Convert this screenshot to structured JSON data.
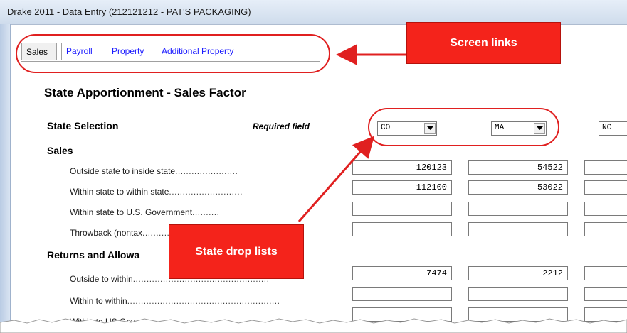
{
  "window": {
    "title": "Drake 2011 - Data Entry (212121212 - PAT'S PACKAGING)"
  },
  "tabs": [
    {
      "label": "Sales",
      "active": true
    },
    {
      "label": "Payroll",
      "active": false
    },
    {
      "label": "Property",
      "active": false
    },
    {
      "label": "Additional Property",
      "active": false
    }
  ],
  "page": {
    "heading": "State Apportionment - Sales Factor",
    "state_selection_label": "State Selection",
    "required_label": "Required field"
  },
  "states": {
    "col1": "CO",
    "col2": "MA",
    "col3": "NC"
  },
  "sales": {
    "label": "Sales",
    "rows": [
      {
        "label": "Outside state to inside state",
        "col1": "120123",
        "col2": "54522"
      },
      {
        "label": "Within state to within state",
        "col1": "112100",
        "col2": "53022"
      },
      {
        "label": "Within state to U.S. Government",
        "col1": "",
        "col2": ""
      },
      {
        "label": "Throwback (nontax",
        "col1": "",
        "col2": ""
      }
    ]
  },
  "returns": {
    "label": "Returns and Allowa",
    "rows": [
      {
        "label": "Outside to within",
        "col1": "7474",
        "col2": "2212"
      },
      {
        "label": "Within to within",
        "col1": "",
        "col2": ""
      },
      {
        "label": "Within to US Gov",
        "col1": "",
        "col2": ""
      }
    ]
  },
  "callouts": {
    "screen_links": "Screen links",
    "state_drop_lists": "State drop lists"
  },
  "colors": {
    "callout": "#f4231b",
    "link": "#1a1aff"
  },
  "icons": {
    "dropdown": "chevron-down-icon"
  }
}
